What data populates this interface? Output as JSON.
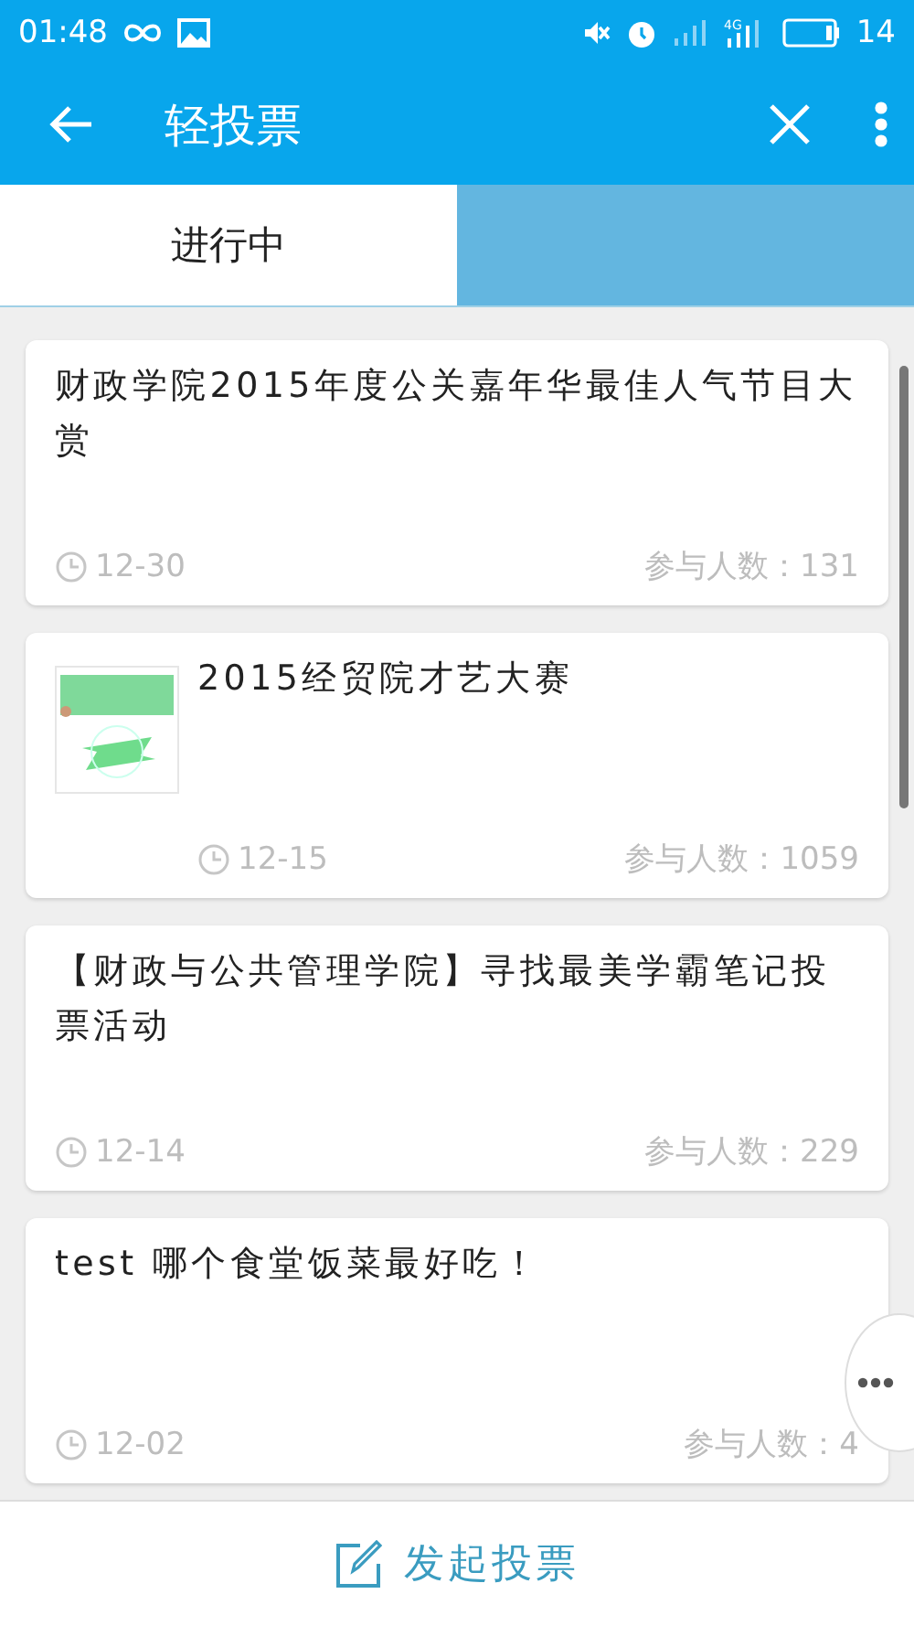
{
  "status_bar": {
    "time": "01:48",
    "network_type": "4G",
    "battery_level_text": "14"
  },
  "app_bar": {
    "title": "轻投票"
  },
  "tabs": [
    {
      "label": "进行中",
      "selected": true
    },
    {
      "selected": false
    }
  ],
  "votes": [
    {
      "title": "财政学院2015年度公关嘉年华最佳人气节目大赏",
      "has_image": false,
      "date": "12-30",
      "participants": "参与人数：131"
    },
    {
      "title": "2015经贸院才艺大赛",
      "has_image": true,
      "date": "12-15",
      "participants": "参与人数：1059"
    },
    {
      "title": "【财政与公共管理学院】寻找最美学霸笔记投票活动",
      "has_image": false,
      "date": "12-14",
      "participants": "参与人数：229"
    },
    {
      "title": "test 哪个食堂饭菜最好吃！",
      "has_image": false,
      "date": "12-02",
      "participants": "参与人数：4"
    }
  ],
  "bottom_action": {
    "label": "发起投票"
  }
}
